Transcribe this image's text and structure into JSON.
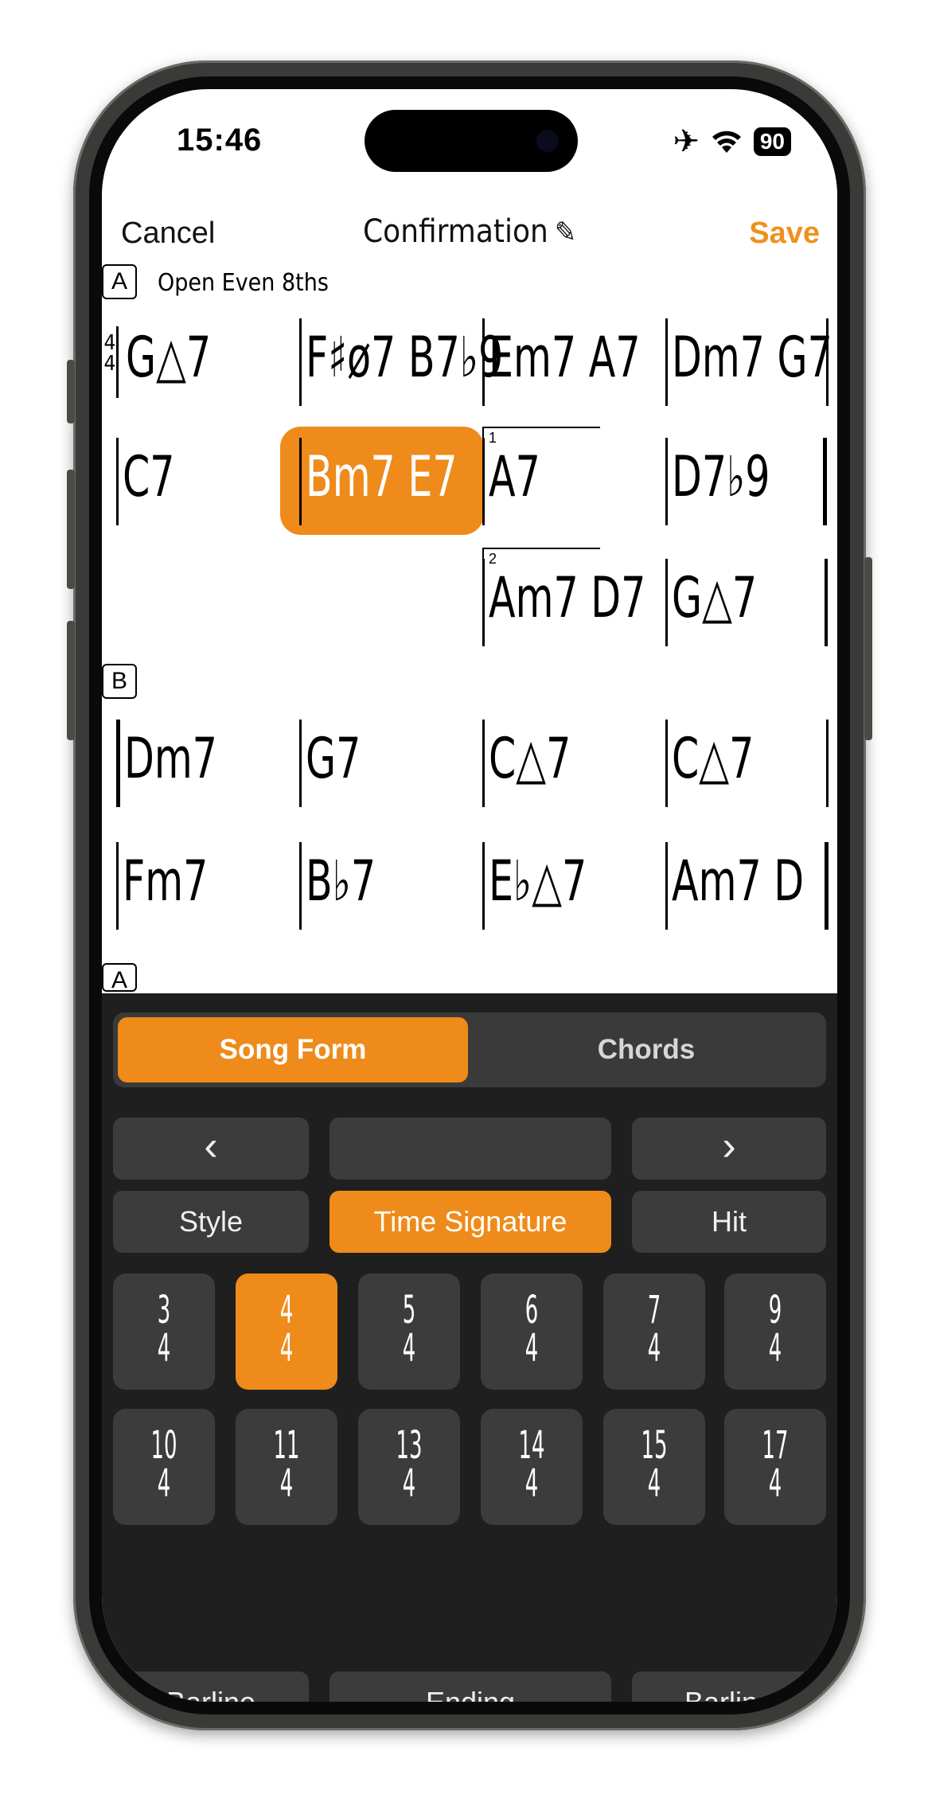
{
  "status": {
    "time": "15:46",
    "battery": "90"
  },
  "nav": {
    "cancel": "Cancel",
    "title": "Confirmation",
    "save": "Save"
  },
  "colors": {
    "accent": "#ee8b1a",
    "panel": "#1f1f1f",
    "button": "#3c3c3c"
  },
  "chart": {
    "sections": [
      "A",
      "B",
      "A"
    ],
    "style": "Open Even 8ths",
    "time_signature": [
      "4",
      "4"
    ],
    "rows": [
      [
        "G△7",
        "F♯ø7  B7♭9",
        "Em7  A7",
        "Dm7  G7"
      ],
      [
        "C7",
        "Bm7  E7",
        "A7",
        "D7♭9"
      ],
      [
        "",
        "",
        "Am7  D7",
        "G△7"
      ],
      [
        "Dm7",
        "G7",
        "C△7",
        "C△7"
      ],
      [
        "Fm7",
        "B♭7",
        "E♭△7",
        "Am7  D"
      ]
    ],
    "endings": [
      "1",
      "2"
    ]
  },
  "panel": {
    "tabs": [
      "Song Form",
      "Chords"
    ],
    "nav_prev": "‹",
    "nav_next": "›",
    "options": [
      "Style",
      "Time Signature",
      "Hit"
    ],
    "time_signatures": [
      {
        "top": "3",
        "bottom": "4"
      },
      {
        "top": "4",
        "bottom": "4"
      },
      {
        "top": "5",
        "bottom": "4"
      },
      {
        "top": "6",
        "bottom": "4"
      },
      {
        "top": "7",
        "bottom": "4"
      },
      {
        "top": "9",
        "bottom": "4"
      },
      {
        "top": "10",
        "bottom": "4"
      },
      {
        "top": "11",
        "bottom": "4"
      },
      {
        "top": "13",
        "bottom": "4"
      },
      {
        "top": "14",
        "bottom": "4"
      },
      {
        "top": "15",
        "bottom": "4"
      },
      {
        "top": "17",
        "bottom": "4"
      }
    ],
    "bottom_row": [
      "Barline",
      "Ending",
      "Barline"
    ]
  }
}
